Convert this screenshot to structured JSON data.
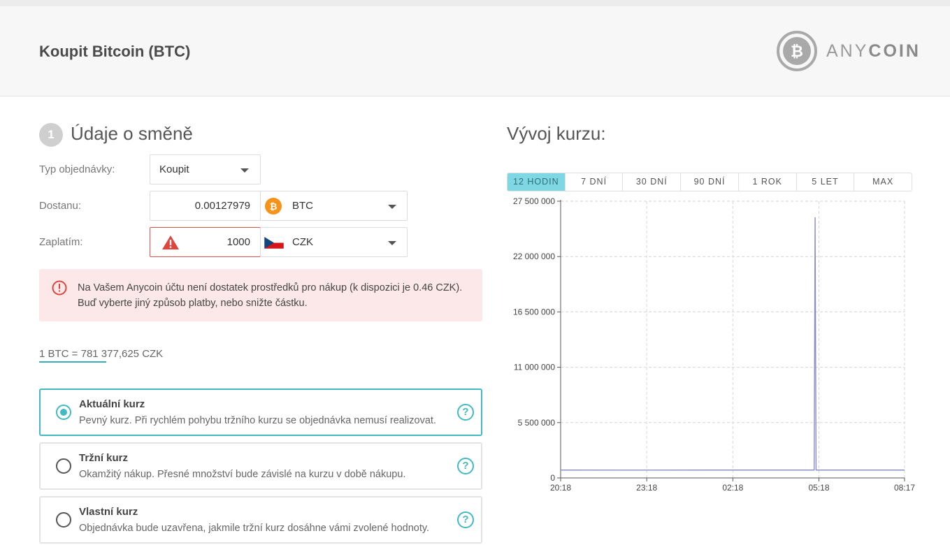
{
  "header": {
    "title": "Koupit Bitcoin (BTC)",
    "logo_light": "ANY",
    "logo_bold": "COIN"
  },
  "step": {
    "number": "1",
    "title": "Údaje o směně"
  },
  "form": {
    "order_type_label": "Typ objednávky:",
    "order_type_value": "Koupit",
    "receive_label": "Dostanu:",
    "receive_amount": "0.00127979",
    "receive_currency": "BTC",
    "pay_label": "Zaplatím:",
    "pay_amount": "1000",
    "pay_currency": "CZK"
  },
  "alert": {
    "text": "Na Vašem Anycoin účtu není dostatek prostředků pro nákup (k dispozici je 0.46 CZK). Buď vyberte jiný způsob platby, nebo snižte částku."
  },
  "rate": {
    "text": "1 BTC = 781 377,625 CZK"
  },
  "options": [
    {
      "title": "Aktuální kurz",
      "desc": "Pevný kurz. Při rychlém pohybu tržního kurzu se objednávka nemusí realizovat.",
      "selected": true
    },
    {
      "title": "Tržní kurz",
      "desc": "Okamžitý nákup. Přesné množství bude závislé na kurzu v době nákupu.",
      "selected": false
    },
    {
      "title": "Vlastní kurz",
      "desc": "Objednávka bude uzavřena, jakmile tržní kurz dosáhne vámi zvolené hodnoty.",
      "selected": false
    }
  ],
  "chart_panel": {
    "title": "Vývoj kurzu:",
    "tabs": [
      "12 HODIN",
      "7 DNÍ",
      "30 DNÍ",
      "90 DNÍ",
      "1 ROK",
      "5 LET",
      "MAX"
    ],
    "active_tab": "12 HODIN"
  },
  "colors": {
    "accent": "#43b9c4",
    "alert_bg": "#fce8e8",
    "error": "#d9534f",
    "line": "#8c8cc8",
    "btc": "#f7931a"
  },
  "chart_data": {
    "type": "line",
    "title": "",
    "xlabel": "",
    "ylabel": "",
    "x_ticks": [
      "20:18",
      "23:18",
      "02:18",
      "05:18",
      "08:17"
    ],
    "y_ticks": [
      "27 500 000",
      "22 000 000",
      "16 500 000",
      "11 000 000",
      "5 500 000",
      "0"
    ],
    "ylim": [
      0,
      27500000
    ],
    "grid": true,
    "series": [
      {
        "x": [
          "20:18",
          "23:18",
          "02:18",
          "04:58",
          "05:08",
          "05:10",
          "05:12",
          "05:18",
          "08:17"
        ],
        "y": [
          781000,
          780000,
          782000,
          781000,
          781000,
          25900000,
          781000,
          781000,
          781377
        ]
      }
    ]
  }
}
